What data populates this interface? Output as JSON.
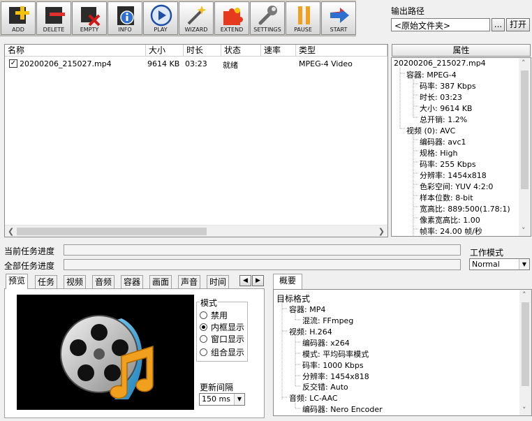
{
  "toolbar": {
    "buttons": [
      {
        "label": "ADD",
        "icon": "add-plus-icon"
      },
      {
        "label": "DELETE",
        "icon": "delete-minus-icon"
      },
      {
        "label": "EMPTY",
        "icon": "empty-x-icon"
      },
      {
        "label": "INFO",
        "icon": "info-icon"
      },
      {
        "label": "PLAY",
        "icon": "play-icon"
      },
      {
        "label": "WIZARD",
        "icon": "wizard-wand-icon"
      },
      {
        "label": "EXTEND",
        "icon": "extend-puzzle-icon"
      },
      {
        "label": "SETTINGS",
        "icon": "settings-wrench-icon"
      },
      {
        "label": "PAUSE",
        "icon": "pause-icon"
      },
      {
        "label": "START",
        "icon": "start-arrow-icon"
      }
    ]
  },
  "output": {
    "label": "输出路径",
    "path": "<原始文件夹>",
    "browse_label": "...",
    "open_label": "打开"
  },
  "filelist": {
    "columns": [
      "名称",
      "大小",
      "时长",
      "状态",
      "速率",
      "类型"
    ],
    "rows": [
      {
        "checked": "✓",
        "name": "20200206_215027.mp4",
        "size": "9614 KB",
        "duration": "03:23",
        "status": "就绪",
        "speed": "",
        "type": "MPEG-4 Video"
      }
    ]
  },
  "properties": {
    "header": "属性",
    "root": "20200206_215027.mp4",
    "container": "容器: MPEG-4",
    "container_items": [
      "码率: 387 Kbps",
      "时长: 03:23",
      "大小: 9614 KB",
      "总开销: 1.2%"
    ],
    "video": "视频 (0): AVC",
    "video_items": [
      "编码器: avc1",
      "规格: High",
      "码率: 255 Kbps",
      "分辨率: 1454x818",
      "色彩空间: YUV 4:2:0",
      "样本位数: 8-bit",
      "宽高比: 889:500(1.78:1)",
      "像素宽高比: 1.00",
      "帧率: 24.00 帧/秒"
    ]
  },
  "progress": {
    "current_label": "当前任务进度",
    "total_label": "全部任务进度",
    "current_value": 0,
    "total_value": 0
  },
  "workmode": {
    "label": "工作模式",
    "value": "Normal"
  },
  "tabs": [
    "预览",
    "任务",
    "视频",
    "音频",
    "容器",
    "画面",
    "声音",
    "时间"
  ],
  "summary_tab": "概要",
  "preview": {
    "mode_label": "模式",
    "modes": [
      {
        "label": "禁用",
        "selected": false
      },
      {
        "label": "内框显示",
        "selected": true
      },
      {
        "label": "窗口显示",
        "selected": false
      },
      {
        "label": "组合显示",
        "selected": false
      }
    ],
    "interval_label": "更新间隔",
    "interval_value": "150 ms"
  },
  "summary": {
    "root": "目标格式",
    "container": "容器: MP4",
    "container_items": [
      "混流: FFmpeg"
    ],
    "video": "视频: H.264",
    "video_items": [
      "编码器: x264",
      "模式: 平均码率模式",
      "码率: 1000 Kbps",
      "分辨率: 1454x818",
      "反交错: Auto"
    ],
    "audio": "音频: LC-AAC",
    "audio_items": [
      "编码器: Nero Encoder"
    ]
  },
  "colors": {
    "toolbar_bg": "#d4d0c8",
    "panel_bg": "#f0f0f0",
    "reel_blue": "#3aa6d8",
    "note_orange": "#f0a01e"
  }
}
